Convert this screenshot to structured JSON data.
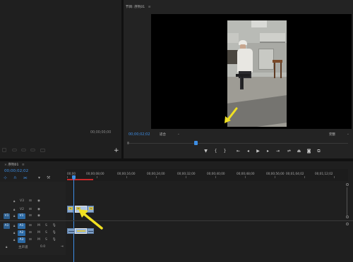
{
  "program_panel": {
    "tab_title": "节目: 序列01",
    "menu_glyph": "≡",
    "timecode": "00;00;02;02",
    "fit_dropdown": "适合",
    "quality_dropdown": "完整"
  },
  "source_panel": {
    "timecode": "00;00;00;00",
    "add_glyph": "+"
  },
  "timeline": {
    "tab_title": "序列01",
    "menu_glyph": "≡",
    "timecode": "00;00;02;02",
    "ruler_labels": [
      "00;00",
      "00;00;08;00",
      "00;00;16;00",
      "00;00;24;00",
      "00;00;32;00",
      "00;00;40;00",
      "00;00;48;00",
      "00;00;56;00",
      "00;01;04;02",
      "00;01;12;02"
    ],
    "tracks": [
      {
        "label": "V3"
      },
      {
        "label": "V2"
      },
      {
        "label": "V1",
        "source": "V1"
      },
      {
        "label": "A1",
        "source": "A1",
        "m": "M",
        "s": "S"
      },
      {
        "label": "A2",
        "m": "M",
        "s": "S"
      },
      {
        "label": "A3",
        "m": "M",
        "s": "S"
      }
    ],
    "master_label": "主声道",
    "master_value": "0.0",
    "clip_fx_labels": [
      "fx",
      "fx",
      "fx"
    ]
  },
  "colors": {
    "timecode_blue": "#3d8ee5",
    "annotation_arrow": "#f0e022",
    "clip_video": "#8ba8cf",
    "clip_audio": "#7d9fc6"
  },
  "icons": [
    "play-icon",
    "step-back-icon",
    "step-forward-icon",
    "go-to-in-icon",
    "go-to-out-icon",
    "marker-icon",
    "lift-icon",
    "extract-icon",
    "export-frame-icon",
    "wrench-icon",
    "snap-icon",
    "linked-icon",
    "lock-icon",
    "eye-icon",
    "mic-icon",
    "arrow-annotation-icon"
  ]
}
